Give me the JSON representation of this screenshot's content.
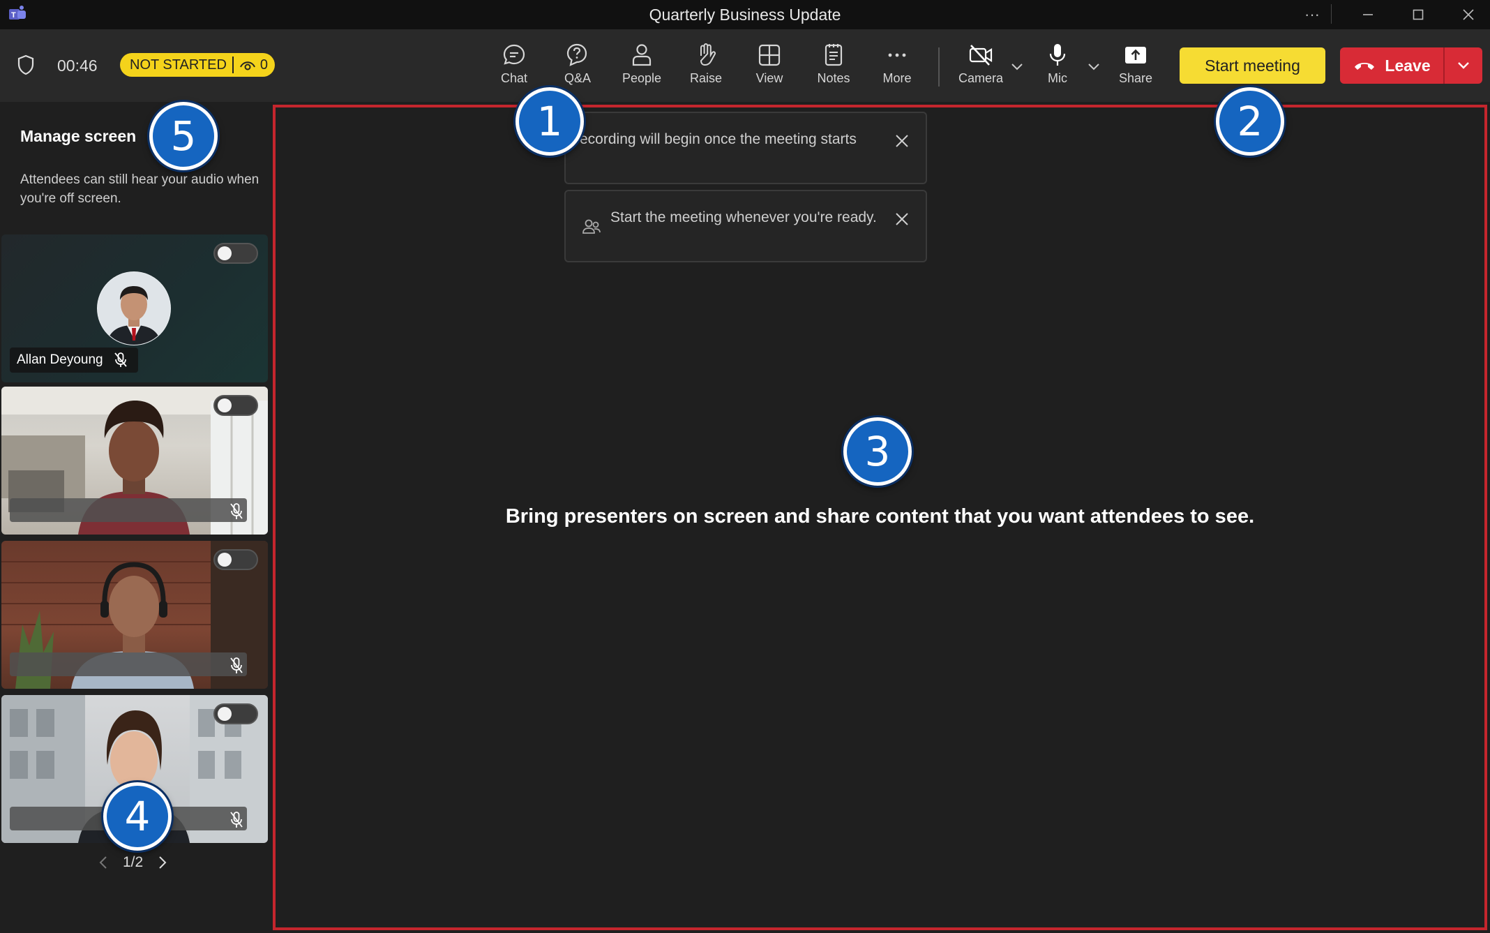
{
  "window": {
    "title": "Quarterly Business Update"
  },
  "toolbar": {
    "timer": "00:46",
    "status": "NOT STARTED",
    "viewer_count": "0",
    "buttons": {
      "chat": "Chat",
      "qa": "Q&A",
      "people": "People",
      "raise": "Raise",
      "view": "View",
      "notes": "Notes",
      "more": "More",
      "camera": "Camera",
      "mic": "Mic",
      "share": "Share"
    },
    "start_meeting": "Start meeting",
    "leave": "Leave"
  },
  "left_panel": {
    "title": "Manage screen",
    "description": "Attendees can still hear your audio when you're off screen.",
    "participants": [
      {
        "name": "Allan Deyoung"
      }
    ],
    "pager": "1/2"
  },
  "stage": {
    "toasts": [
      {
        "text": "ecording will begin once the meeting starts"
      },
      {
        "text": "Start the meeting whenever you're ready."
      }
    ],
    "message": "Bring presenters on screen and share content that you want attendees to see."
  },
  "callouts": [
    "1",
    "2",
    "3",
    "4",
    "5"
  ],
  "colors": {
    "accent_yellow": "#f6dc33",
    "leave_red": "#d82b36",
    "stage_border": "#c4262d",
    "callout_blue": "#1565c0"
  }
}
